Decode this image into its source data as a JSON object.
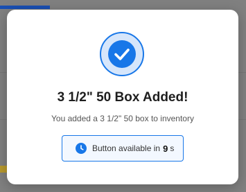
{
  "modal": {
    "title": "3 1/2\" 50 Box Added!",
    "message": "You added a 3 1/2\" 50 box to inventory",
    "status_icon": "check-circle-icon",
    "timer": {
      "icon": "clock-icon",
      "prefix": "Button available in",
      "seconds": "9",
      "unit": "s"
    }
  },
  "colors": {
    "accent": "#1877e8",
    "accent_light": "#d6e6fb",
    "backdrop": "#808080"
  }
}
